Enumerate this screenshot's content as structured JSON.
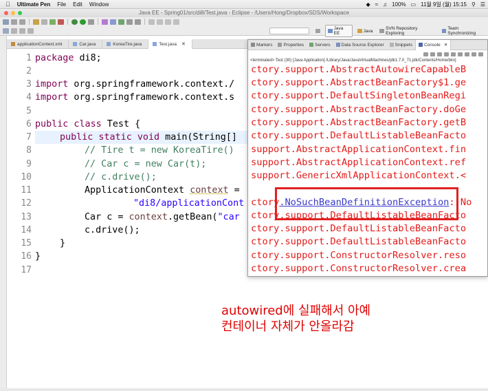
{
  "menubar": {
    "app_name": "Ultimate Pen",
    "menus": [
      "File",
      "Edit",
      "Window"
    ],
    "battery": "100%",
    "datetime": "11월 9일 (월)  15:15"
  },
  "window": {
    "title": "Java EE - Spring01/src/di8/Test.java - Eclipse - /Users/Hong/Dropbox/SDS/Workspace"
  },
  "perspectives": [
    "Java EE",
    "Java",
    "SVN Repository Exploring",
    "Team Synchronizing"
  ],
  "editor": {
    "tabs": [
      {
        "label": "applicationContext.xml",
        "type": "xml"
      },
      {
        "label": "Car.java",
        "type": "java"
      },
      {
        "label": "KoreaTire.java",
        "type": "java"
      },
      {
        "label": "Test.java",
        "type": "java",
        "active": true
      }
    ],
    "line_numbers": [
      "1",
      "2",
      "3",
      "4",
      "5",
      "6",
      "7",
      "8",
      "9",
      "10",
      "11",
      "12",
      "13",
      "14",
      "15",
      "16",
      "17"
    ],
    "code": {
      "l1_kw": "package",
      "l1_rest": " di8;",
      "l3_kw": "import",
      "l3_rest": " org.springframework.context./",
      "l4_kw": "import",
      "l4_rest": " org.springframework.context.s",
      "l6_kw": "public class",
      "l6_rest": " Test {",
      "l7_kw": "public static void",
      "l7_rest": " main(String[]",
      "l8": "// Tire t = new KoreaTire()",
      "l9": "// Car c = new Car(t);",
      "l10": "// c.drive();",
      "l11_a": "ApplicationContext ",
      "l11_b": "context",
      "l11_c": " =",
      "l12": "\"di8/applicationCont",
      "l13_a": "Car c = ",
      "l13_b": "context",
      "l13_c": ".getBean(",
      "l13_d": "\"car",
      "l14": "c.drive();",
      "l15": "}",
      "l16": "}"
    }
  },
  "console": {
    "tabs": [
      "Markers",
      "Properties",
      "Servers",
      "Data Source Explorer",
      "Snippets",
      "Console"
    ],
    "status": "<terminated> Test (30) [Java Application] /Library/Java/JavaVirtualMachines/jdk1.7.0_71.jdk/Contents/Home/bin/j",
    "lines": [
      "ctory.support.AbstractAutowireCapableB",
      "ctory.support.AbstractBeanFactory$1.ge",
      "ctory.support.DefaultSingletonBeanRegi",
      "ctory.support.AbstractBeanFactory.doGe",
      "ctory.support.AbstractBeanFactory.getB",
      "ctory.support.DefaultListableBeanFacto",
      "support.AbstractApplicationContext.fin",
      "support.AbstractApplicationContext.ref",
      "support.GenericXmlApplicationContext.<",
      "",
      "",
      "ctory.support.DefaultListableBeanFacto",
      "ctory.support.DefaultListableBeanFacto",
      "ctory.support.DefaultListableBeanFacto",
      "ctory.support.ConstructorResolver.reso",
      "ctory.support.ConstructorResolver.crea"
    ],
    "exception_prefix": "ctory",
    "exception_link": ".NoSuchBeanDefinitionException",
    "exception_suffix": ": No"
  },
  "annotation": {
    "line1": "autowired에 실패해서 아예",
    "line2": "컨테이너 자체가 안올라감"
  },
  "colors": {
    "keyword": "#7f0055",
    "comment": "#3f7f5f",
    "string": "#2a00ff",
    "field": "#6a3e3e",
    "console_error": "#e41a1a",
    "annotation_red": "#e00000"
  }
}
